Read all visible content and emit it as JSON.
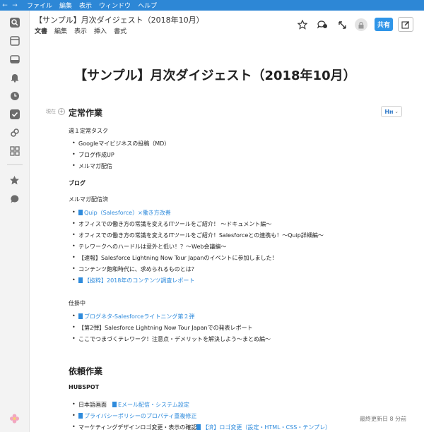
{
  "menubar": {
    "back": "←",
    "forward": "→",
    "items": [
      "ファイル",
      "編集",
      "表示",
      "ウィンドウ",
      "ヘルプ"
    ]
  },
  "rail_icons": [
    "search-icon",
    "inbox-icon",
    "archive-icon",
    "bell-icon",
    "clock-icon",
    "check-icon",
    "link-icon",
    "grid-icon",
    "star-icon",
    "chat-icon",
    "flower-avatar"
  ],
  "doc": {
    "title": "【サンプル】月次ダイジェスト（2018年10月）",
    "menu": [
      "文書",
      "編集",
      "表示",
      "挿入",
      "書式"
    ],
    "share_label": "共有"
  },
  "content": {
    "heading": "【サンプル】月次ダイジェスト（2018年10月）",
    "now_label": "現在",
    "heading_style_label": "Hн",
    "section1": {
      "title": "定常作業",
      "weekly_label": "週１定常タスク",
      "weekly_items": [
        "Googleマイビジネスの投稿（MD）",
        "ブログ作成UP",
        "メルマガ配信"
      ],
      "blog_label": "ブログ",
      "mail_label": "メルマガ配信済",
      "mail_items": [
        {
          "text": "Quip（Salesforce）×働き方改善",
          "link": true
        },
        {
          "text": "オフィスでの働き方の常識を変えるITツールをご紹介！ ～ドキュメント編～",
          "link": false
        },
        {
          "text": "オフィスでの働き方の常識を変えるITツールをご紹介！Salesforceとの連携も！～Quip詳細編～",
          "link": false
        },
        {
          "text": "テレワークへのハードルは意外と低い！？～Web会議編～",
          "link": false
        },
        {
          "text": "【速報】Salesforce Lightning Now Tour Japanのイベントに参加しました！",
          "link": false
        },
        {
          "text": "コンテンツ飽和時代に、求められるものとは？",
          "link": false
        },
        {
          "text": "【抜粋】2018年のコンテンツ調査レポート",
          "link": true
        }
      ],
      "inprogress_label": "仕掛中",
      "inprogress_items": [
        {
          "text": "ブログネタ-Salesforceライトニング第２弾",
          "link": true
        },
        {
          "text": "【第2弾】Salesforce Lightning Now Tour Japanでの発表レポート",
          "link": false
        },
        {
          "text": "ここでつまづくテレワーク！注意点・デメリットを解決しよう～まとめ編～",
          "link": false
        }
      ]
    },
    "section2": {
      "title": "依頼作業",
      "hubspot_label": "HUBSPOT",
      "items": [
        {
          "prefix": "日本語画面",
          "link_text": "Eメール配信・システム設定"
        },
        {
          "prefix": "",
          "link_text": "プライバシーポリシーのプロパティ重複修正"
        },
        {
          "prefix": "マーケティングデザインロゴ変更・表示の確認",
          "link_text": "【済】ロゴ変更（設定・HTML・CSS・テンプレ）"
        }
      ]
    },
    "footer": "最終更新日 8 分前"
  }
}
